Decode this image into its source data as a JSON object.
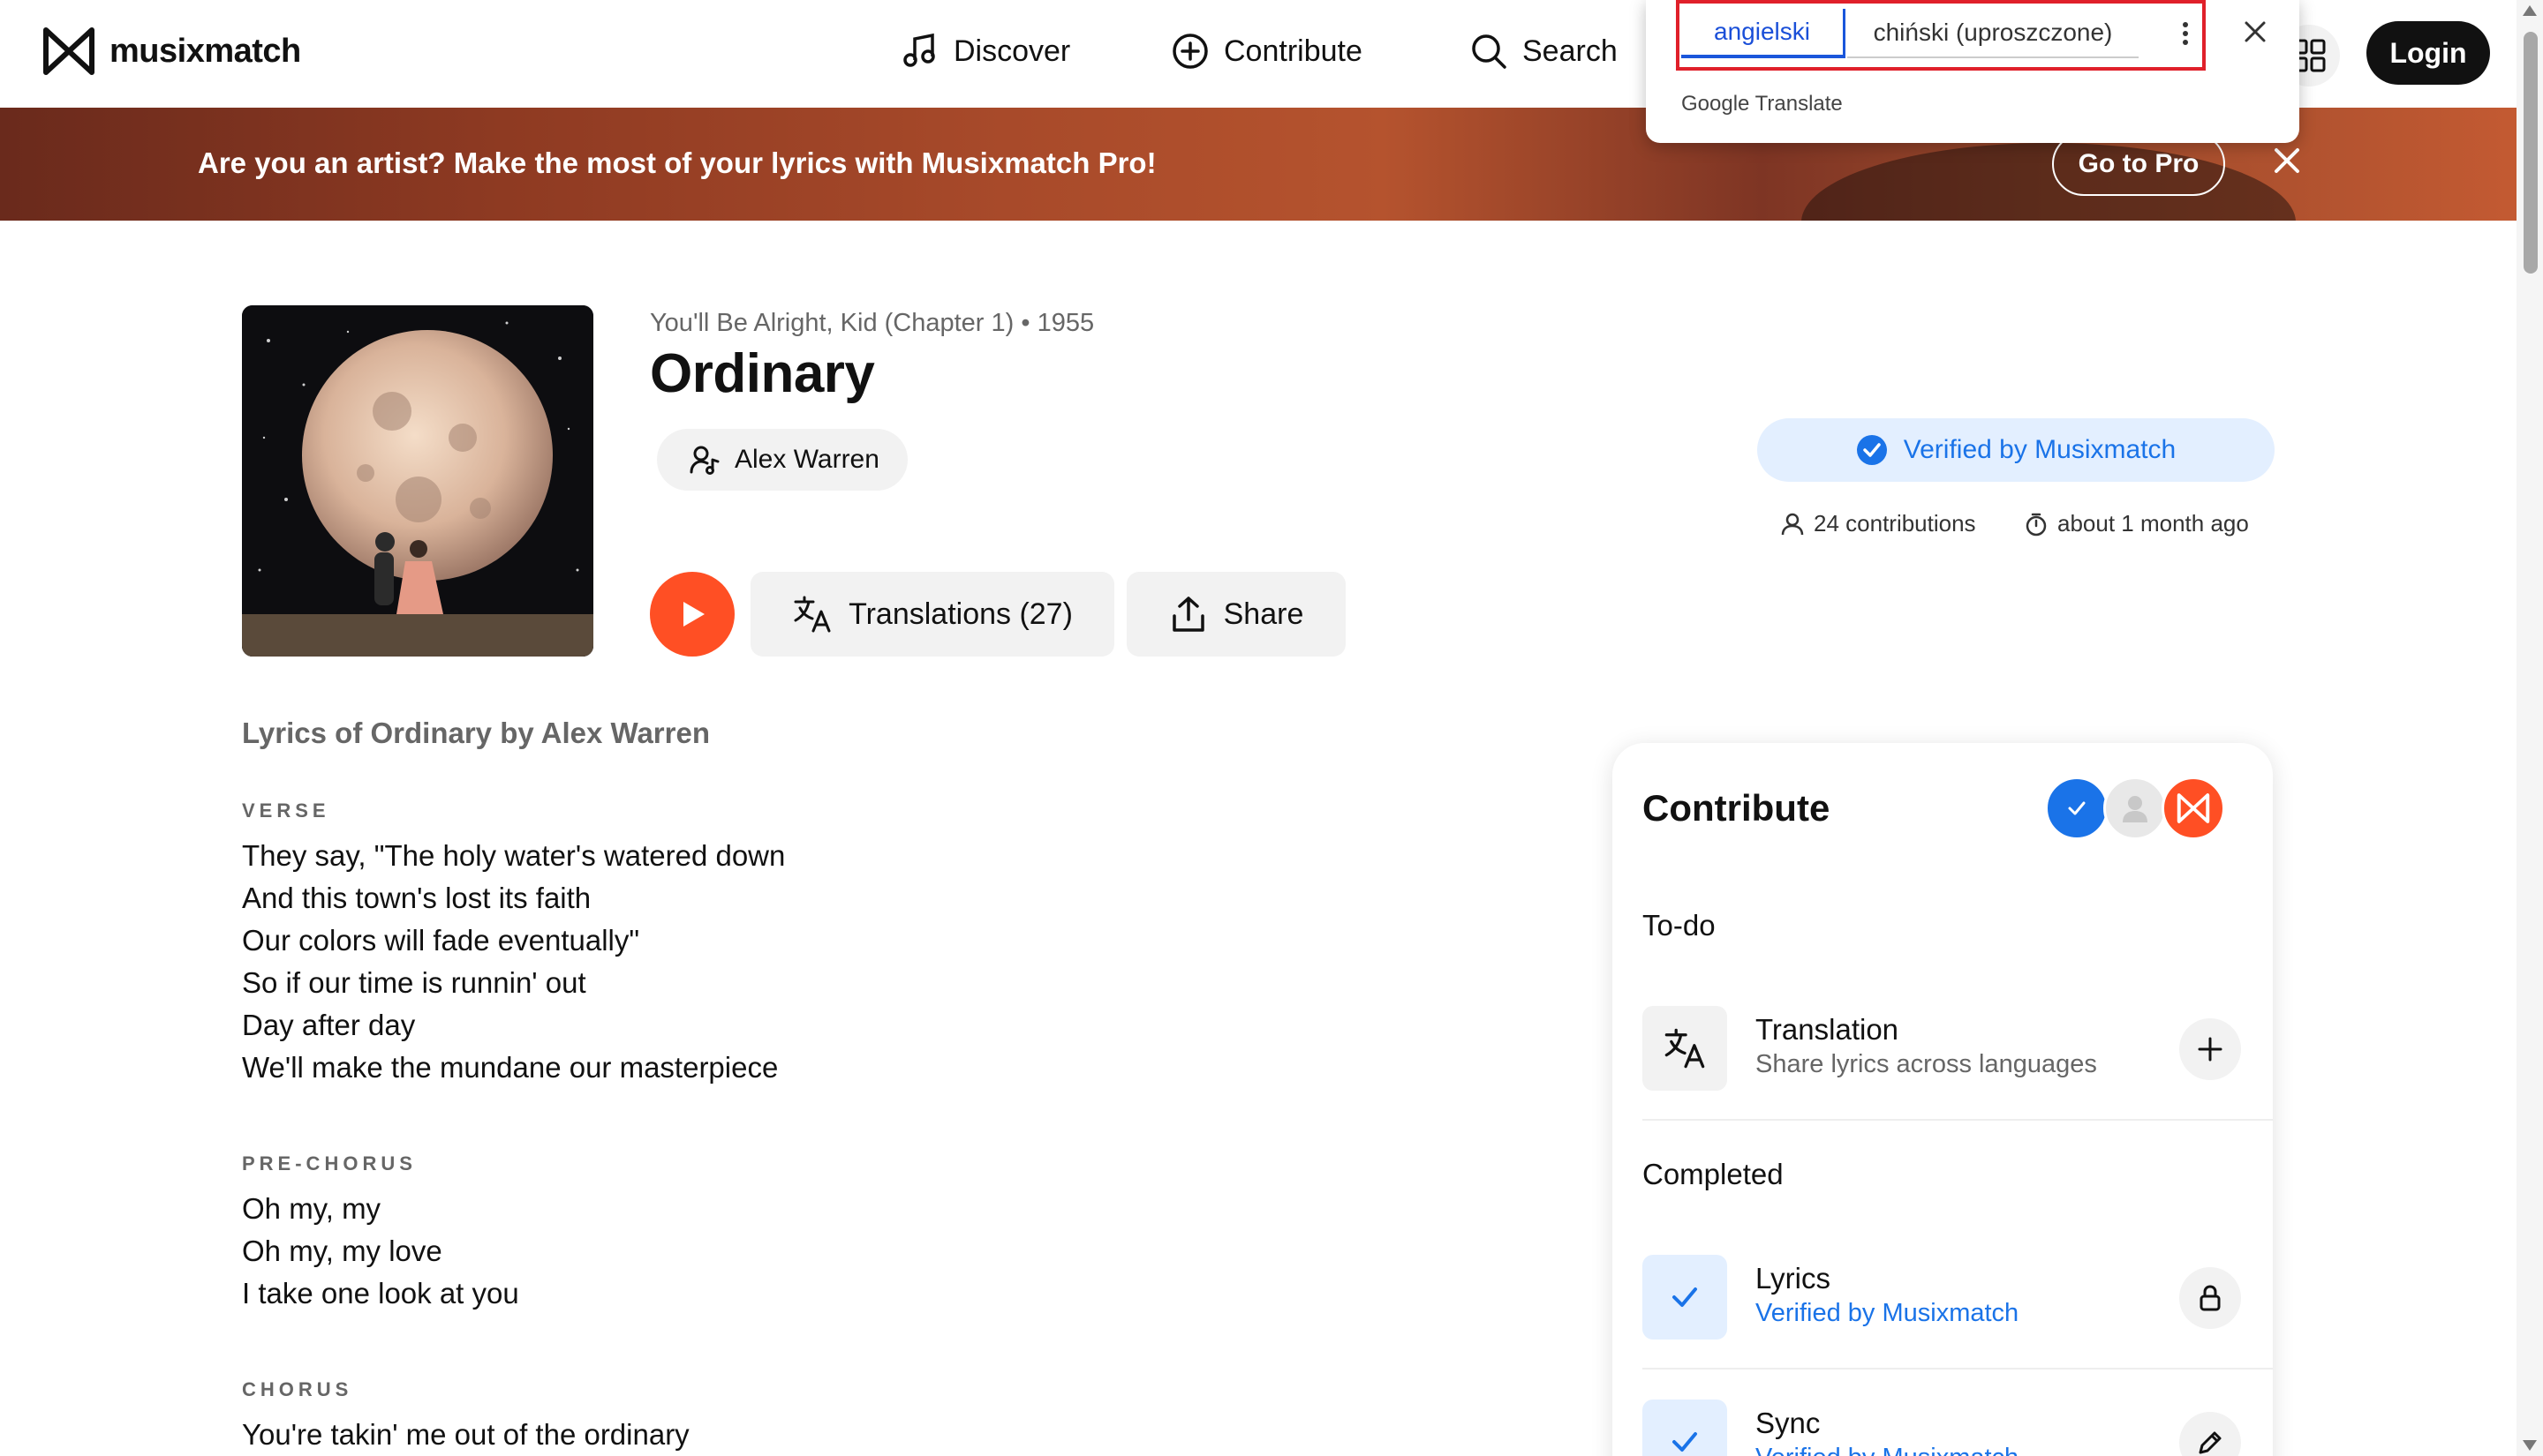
{
  "header": {
    "logo_text": "musixmatch",
    "nav": {
      "discover": "Discover",
      "contribute": "Contribute",
      "search": "Search"
    },
    "login_label": "Login"
  },
  "banner": {
    "text": "Are you an artist? Make the most of your lyrics with Musixmatch Pro!",
    "cta": "Go to Pro"
  },
  "song": {
    "album_line": "You'll Be Alright, Kid (Chapter 1) • 1955",
    "title": "Ordinary",
    "artist": "Alex Warren",
    "translations_label": "Translations (27)",
    "share_label": "Share",
    "verified_label": "Verified by Musixmatch",
    "contributions": "24 contributions",
    "updated": "about 1 month ago"
  },
  "lyrics": {
    "heading": "Lyrics of Ordinary by Alex Warren",
    "sections": [
      {
        "label": "VERSE",
        "lines": [
          "They say, \"The holy water's watered down",
          "And this town's lost its faith",
          "Our colors will fade eventually\"",
          "So if our time is runnin' out",
          "Day after day",
          "We'll make the mundane our masterpiece"
        ]
      },
      {
        "label": "PRE-CHORUS",
        "lines": [
          "Oh my, my",
          "Oh my, my love",
          "I take one look at you"
        ]
      },
      {
        "label": "CHORUS",
        "lines": [
          "You're takin' me out of the ordinary"
        ]
      }
    ]
  },
  "contribute_panel": {
    "title": "Contribute",
    "todo_label": "To-do",
    "completed_label": "Completed",
    "todo_items": [
      {
        "title": "Translation",
        "subtitle": "Share lyrics across languages",
        "action_icon": "plus-icon"
      }
    ],
    "completed_items": [
      {
        "title": "Lyrics",
        "subtitle": "Verified by Musixmatch",
        "action_icon": "lock-icon"
      },
      {
        "title": "Sync",
        "subtitle": "Verified by Musixmatch",
        "action_icon": "pencil-icon"
      }
    ]
  },
  "google_translate": {
    "source_language": "angielski",
    "target_language": "chiński (uproszczone)",
    "brand_google": "Google",
    "brand_translate": "Translate"
  },
  "colors": {
    "accent_orange": "#ff4f24",
    "verified_blue": "#1a73e8",
    "verified_bg": "#e3efff",
    "highlight_red": "#e0202a"
  }
}
